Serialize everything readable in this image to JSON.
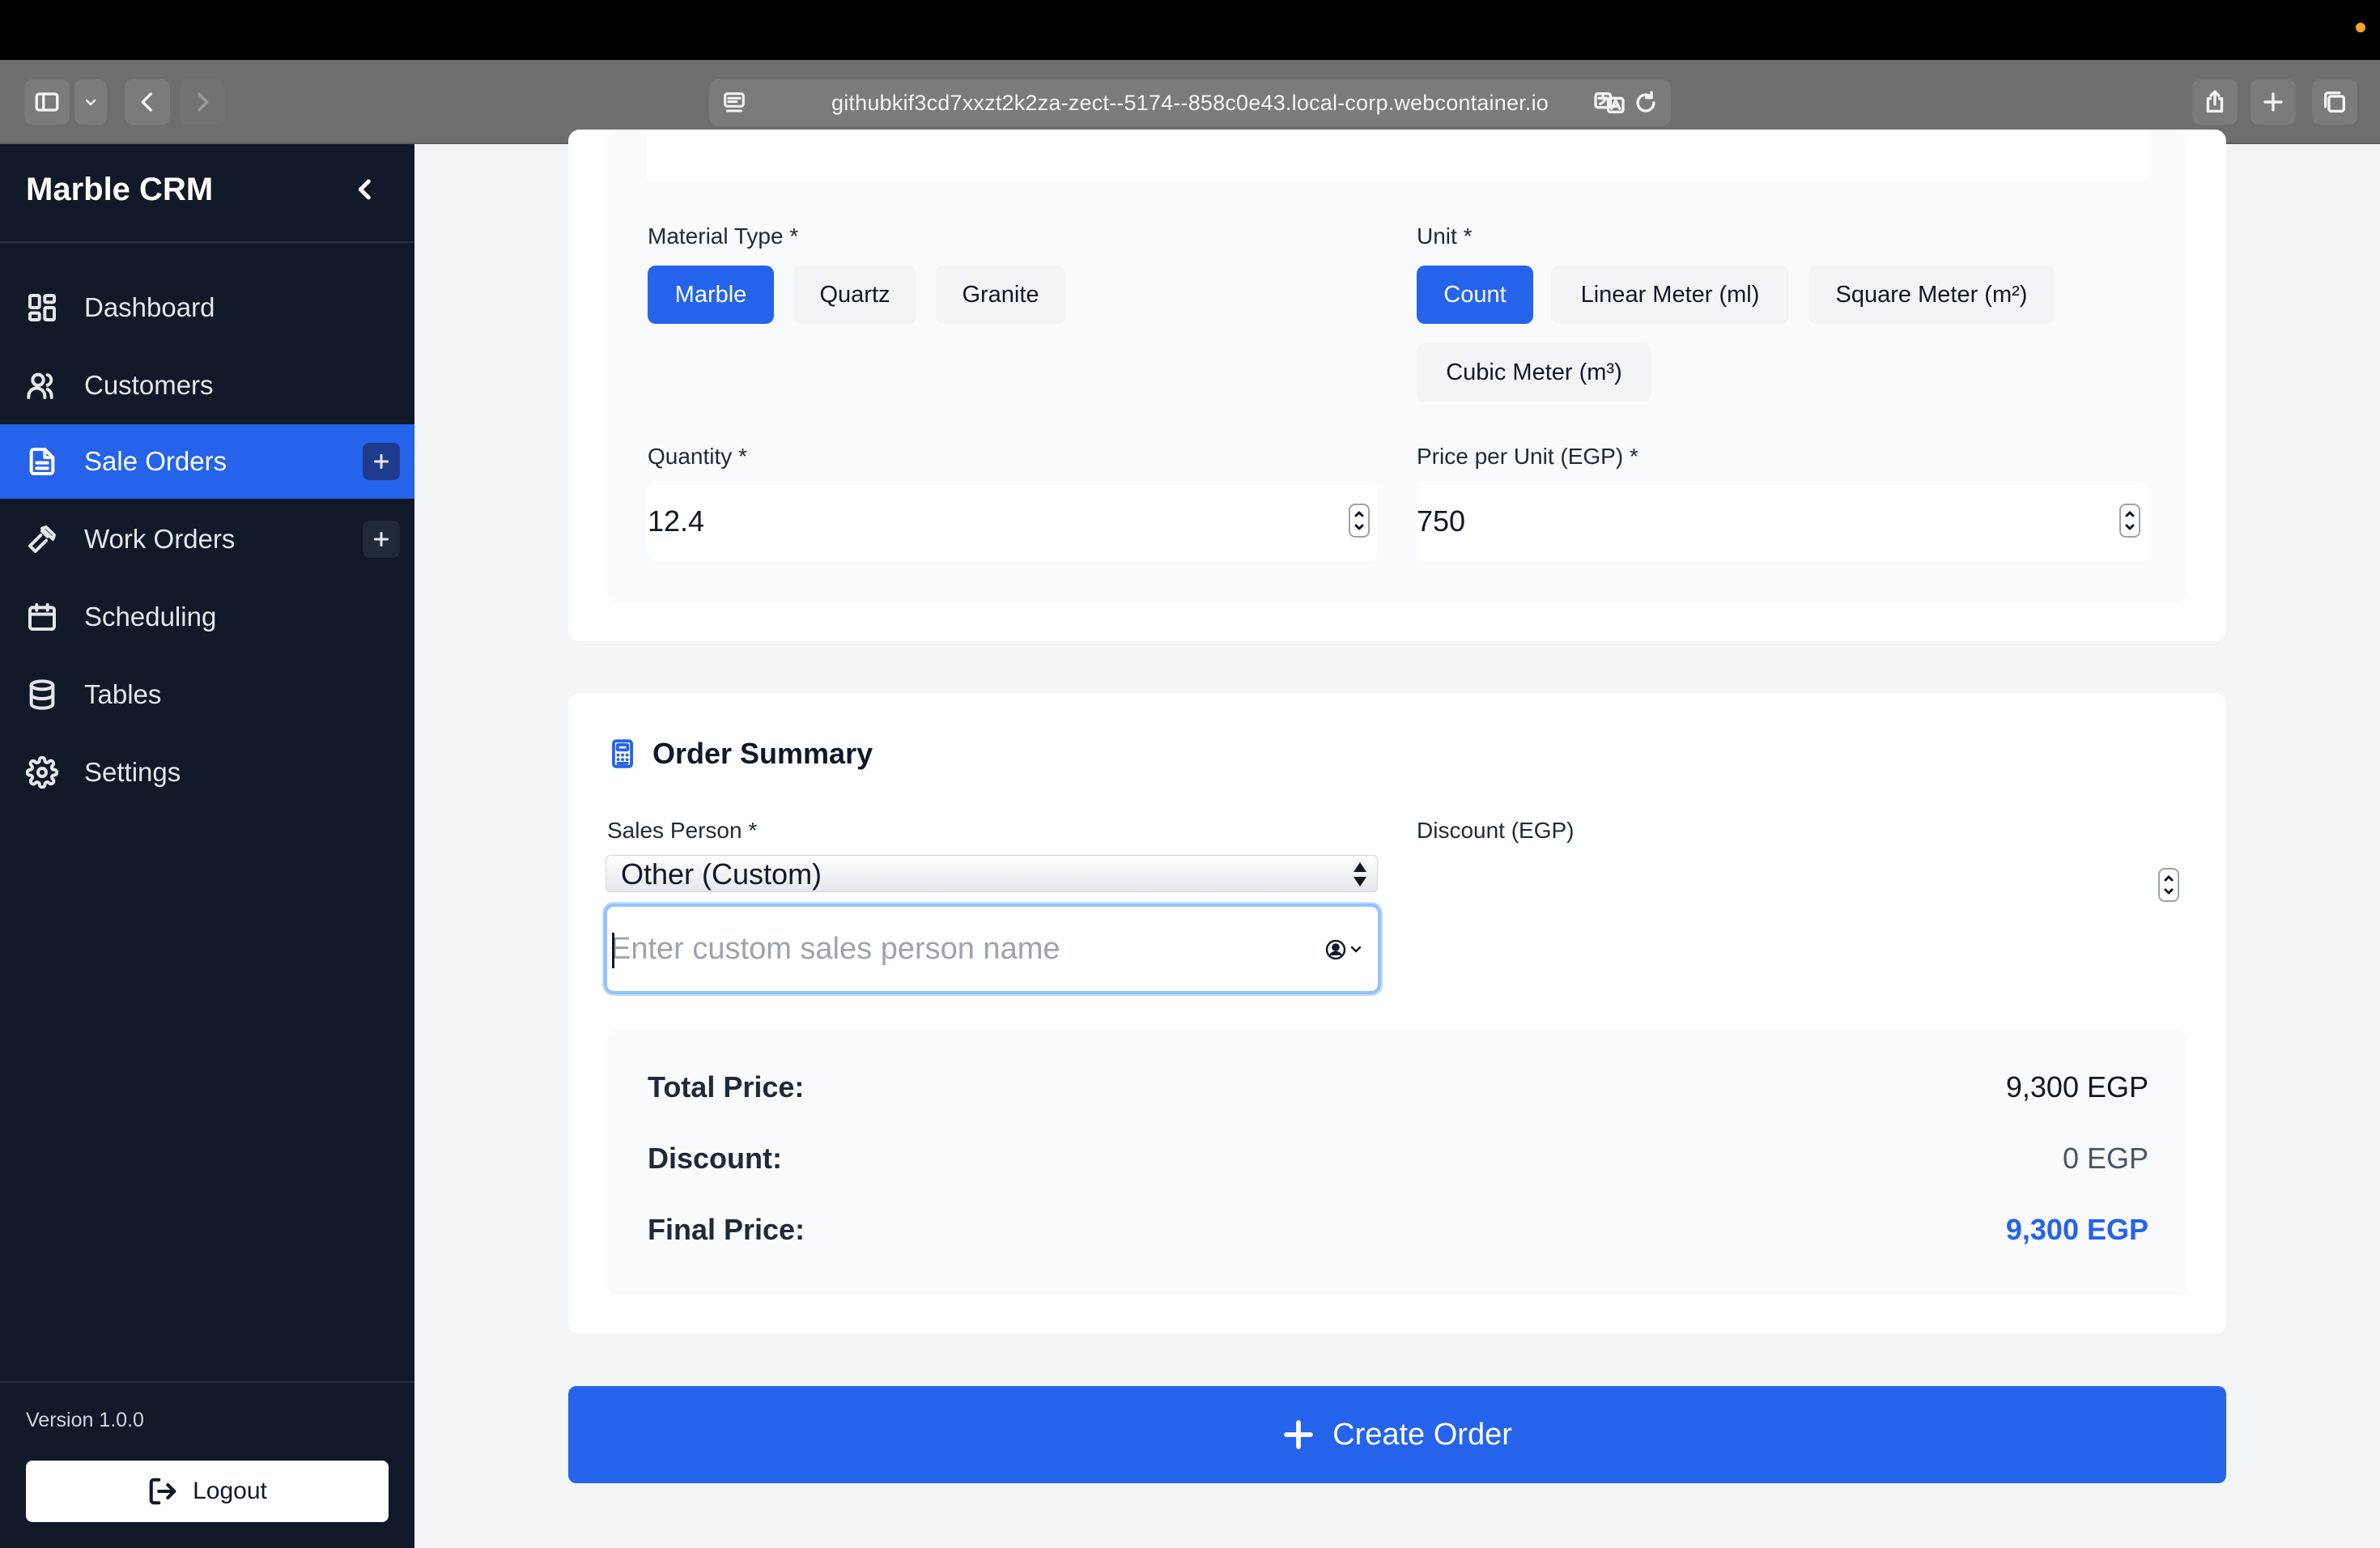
{
  "browser": {
    "url": "githubkif3cd7xxzt2k2za-zect--5174--858c0e43.local-corp.webcontainer.io"
  },
  "sidebar": {
    "brand": "Marble CRM",
    "items": [
      {
        "label": "Dashboard",
        "icon": "dashboard-grid-icon"
      },
      {
        "label": "Customers",
        "icon": "users-icon"
      },
      {
        "label": "Sale Orders",
        "icon": "document-icon",
        "active": true
      },
      {
        "label": "Work Orders",
        "icon": "hammer-icon"
      },
      {
        "label": "Scheduling",
        "icon": "calendar-icon"
      },
      {
        "label": "Tables",
        "icon": "database-icon"
      },
      {
        "label": "Settings",
        "icon": "gear-icon"
      }
    ],
    "version": "Version 1.0.0",
    "logout_label": "Logout"
  },
  "item_form": {
    "material_type_label": "Material Type *",
    "material_types": [
      "Marble",
      "Quartz",
      "Granite"
    ],
    "material_selected": "Marble",
    "unit_label": "Unit *",
    "units": [
      "Count",
      "Linear Meter (ml)",
      "Square Meter (m²)",
      "Cubic Meter (m³)"
    ],
    "unit_selected": "Count",
    "quantity_label": "Quantity *",
    "quantity_value": "12.4",
    "price_label": "Price per Unit (EGP) *",
    "price_value": "750"
  },
  "order_summary": {
    "title": "Order Summary",
    "sales_person_label": "Sales Person *",
    "sales_person_selected": "Other (Custom)",
    "custom_sales_person_placeholder": "Enter custom sales person name",
    "discount_label": "Discount (EGP)",
    "total_price_label": "Total Price:",
    "total_price_value": "9,300 EGP",
    "discount_row_label": "Discount:",
    "discount_row_value": "0 EGP",
    "final_price_label": "Final Price:",
    "final_price_value": "9,300 EGP"
  },
  "actions": {
    "create_order_label": "Create Order"
  },
  "colors": {
    "primary": "#2563eb",
    "sidebar_bg": "#111827",
    "page_bg": "#f3f4f6"
  }
}
